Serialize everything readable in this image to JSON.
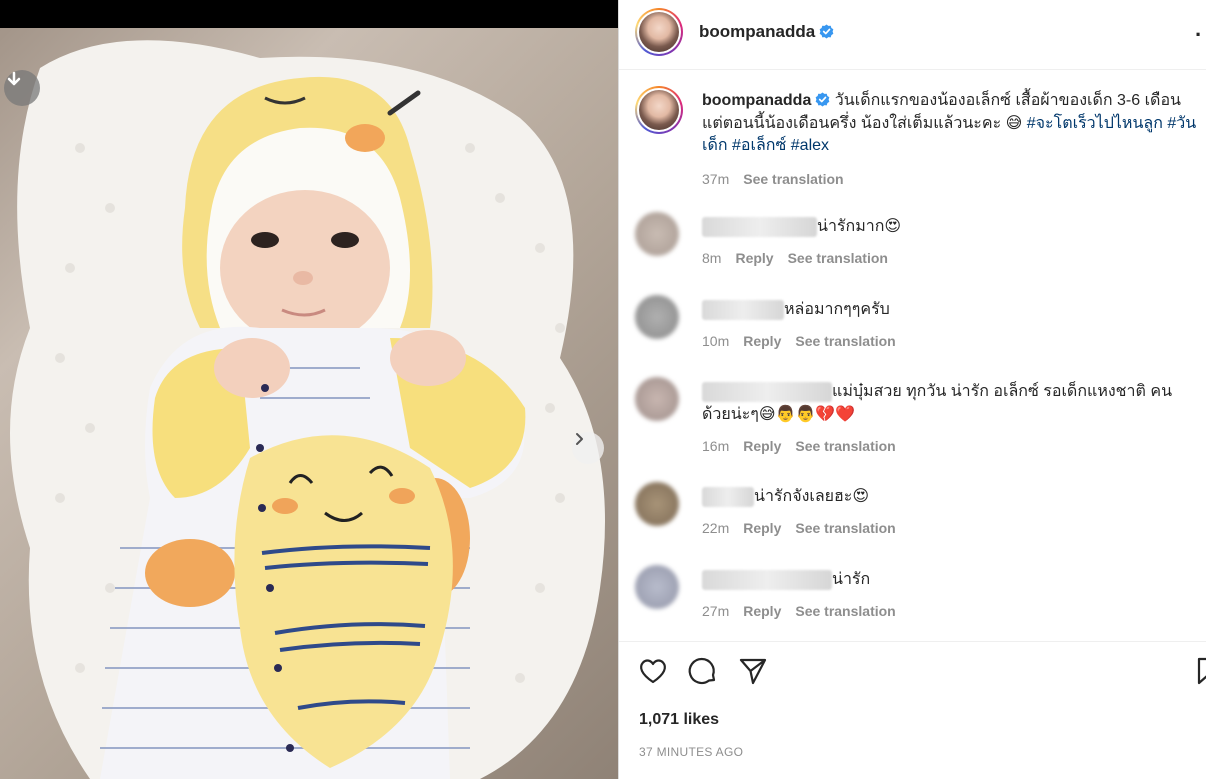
{
  "post": {
    "username": "boompanadda",
    "caption_text": "วันเด็กแรกของน้องอเล็กซ์ เสื้อผ้าของเด็ก 3-6 เดือน แต่ตอนนี้น้องเดือนครึ่ง น้องใส่เต็มแล้วนะคะ 😅",
    "hashtags": [
      "#จะโตเร็วไปไหนลูก",
      "#วันเด็ก",
      "#อเล็กซ์",
      "#alex"
    ],
    "caption_time": "37m",
    "see_translation": "See translation",
    "likes": "1,071 likes",
    "posted_ago": "37 MINUTES AGO"
  },
  "comments": [
    {
      "text": "น่ารักมาก😍",
      "time": "8m",
      "reply": "Reply",
      "translate": "See translation"
    },
    {
      "text": "หล่อมากๆๆครับ",
      "time": "10m",
      "reply": "Reply",
      "translate": "See translation"
    },
    {
      "text": "แม่บุ๋มสวย ทุกวัน น่ารัก อเล็กซ์ รอเด็กแหงชาติ คน",
      "text2": "ด้วยน่ะๆ😅👨👨💔❤️",
      "time": "16m",
      "reply": "Reply",
      "translate": "See translation"
    },
    {
      "text": "น่ารักจังเลยฮะ😍",
      "time": "22m",
      "reply": "Reply",
      "translate": "See translation"
    },
    {
      "text": "น่ารัก",
      "time": "27m",
      "reply": "Reply",
      "translate": "See translation"
    }
  ],
  "icons": {
    "download": "download-icon",
    "next": "chevron-right-icon",
    "like": "heart-icon",
    "comment": "comment-icon",
    "share": "share-icon",
    "save": "bookmark-icon",
    "more": "more-icon",
    "verified": "verified-badge-icon"
  },
  "colors": {
    "verified": "#3897f0",
    "hashtag": "#00376b",
    "muted": "#8e8e8e"
  }
}
